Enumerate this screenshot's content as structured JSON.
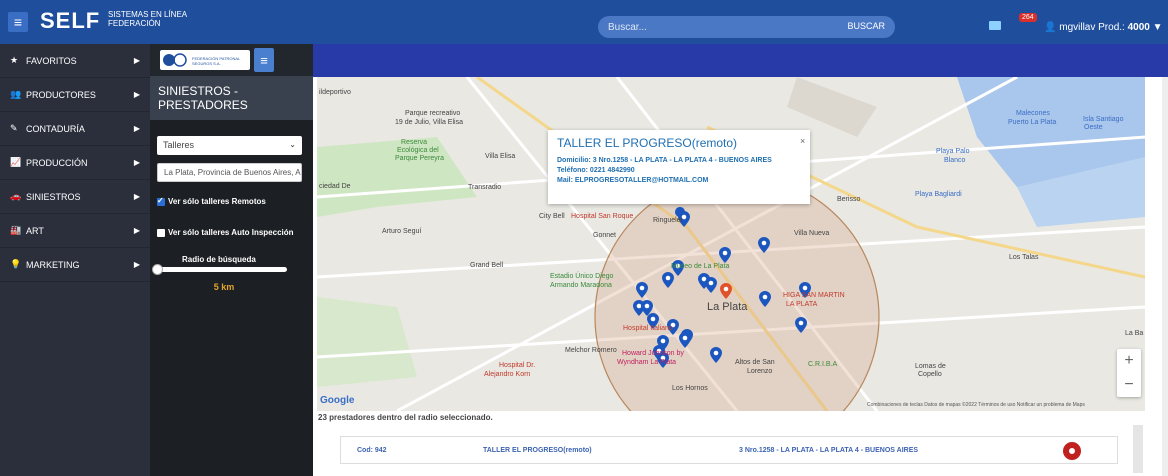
{
  "header": {
    "brand": "SELF",
    "brand_sub1": "SISTEMAS EN LÍNEA",
    "brand_sub2": "FEDERACIÓN",
    "search_placeholder": "Buscar...",
    "search_button": "BUSCAR",
    "notif_count": "264",
    "user_name": "mgvillav",
    "user_prod": "Prod.:",
    "user_code": "4000"
  },
  "sidebar": {
    "items": [
      {
        "label": "FAVORITOS"
      },
      {
        "label": "PRODUCTORES"
      },
      {
        "label": "CONTADURÍA"
      },
      {
        "label": "PRODUCCIÓN"
      },
      {
        "label": "SINIESTROS"
      },
      {
        "label": "ART"
      },
      {
        "label": "MARKETING"
      }
    ]
  },
  "panel": {
    "logo_text1": "FEDERACIÓN PATRONAL",
    "logo_text2": "SEGUROS S.A.",
    "title": "SINIESTROS - PRESTADORES",
    "type_select": "Talleres",
    "address": "La Plata, Provincia de Buenos Aires, A",
    "check_remote": "Ver sólo talleres Remotos",
    "check_auto": "Ver sólo talleres Auto Inspección",
    "radius_label": "Radio de búsqueda",
    "radius_value": "5 km"
  },
  "map": {
    "labels": [
      "ildeportivo",
      "Parque recreativo",
      "19 de Julio, Villa Elisa",
      "Malecones",
      "Puerto La Plata",
      "Isla Santiago",
      "Oeste",
      "Reserva",
      "Ecológica del",
      "Parque Pereyra",
      "Villa Elisa",
      "Playa Palo",
      "Blanco",
      "Transradio",
      "ciedad De",
      "Berisso",
      "Playa Bagliardi",
      "City Bell",
      "Hospital San Roque",
      "Gonnet",
      "Ringuelet",
      "Villa Nueva",
      "Arturo Seguí",
      "Grand Bell",
      "Museo de La Plata",
      "Estadio Único Diego",
      "Armando Maradona",
      "La Plata",
      "HIGA SAN MARTIN",
      "LA PLATA",
      "Los Talas",
      "Hospital Italiano",
      "Melchor Romero",
      "Howard Johnson by",
      "Wyndham La Plata",
      "Hospital Dr.",
      "Alejandro Korn",
      "Altos de San",
      "Lorenzo",
      "C.R.I.B.A",
      "Lomas de",
      "Copello",
      "Los Hornos",
      "La Ba"
    ],
    "footer": "Combinaciones de teclas   Datos de mapas ©2022   Términos de uso   Notificar un problema de Maps",
    "google": "Google"
  },
  "infowindow": {
    "title": "TALLER EL PROGRESO(remoto)",
    "domicilio": "Domicilio: 3 Nro.1258 - LA PLATA - LA PLATA 4 - BUENOS AIRES",
    "telefono": "Teléfono: 0221 4842990",
    "mail": "Mail: ELPROGRESOTALLER@HOTMAIL.COM",
    "close": "×"
  },
  "results": {
    "summary": "23 prestadores dentro del radio seleccionado.",
    "rows": [
      {
        "cod": "Cod: 942",
        "name": "TALLER EL PROGRESO(remoto)",
        "addr": "3 Nro.1258 - LA PLATA - LA PLATA 4 - BUENOS AIRES"
      }
    ]
  },
  "colors": {
    "header": "#1f4f9c",
    "sidebar": "#2a2f3b",
    "accent": "#e0a52c"
  }
}
